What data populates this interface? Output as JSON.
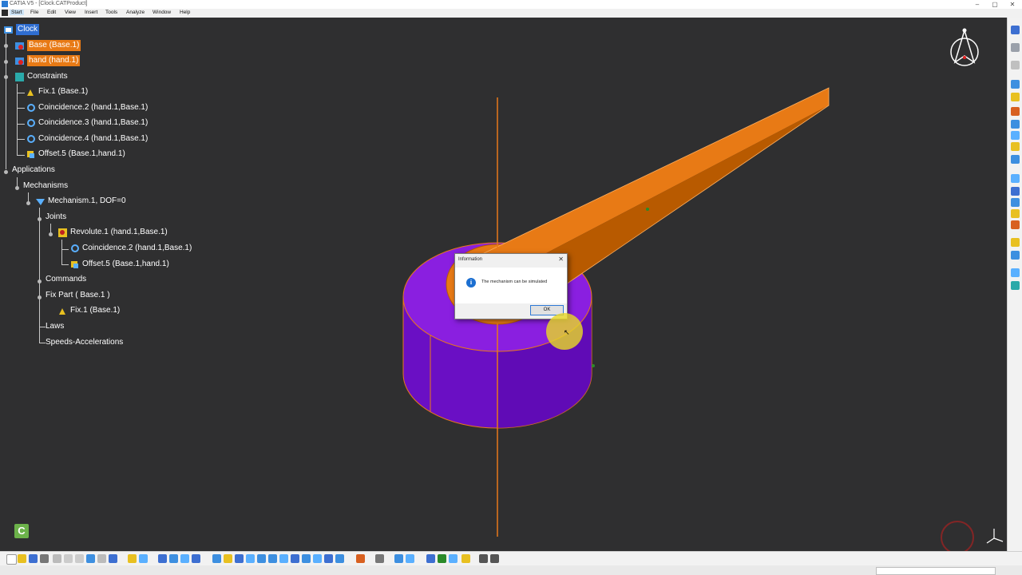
{
  "window": {
    "title": "CATIA V5 - [Clock.CATProduct]",
    "minimize": "–",
    "maximize": "▢",
    "close": "✕"
  },
  "menubar": {
    "items": [
      "Start",
      "File",
      "Edit",
      "View",
      "Insert",
      "Tools",
      "Analyze",
      "Window",
      "Help"
    ]
  },
  "tree": {
    "root": "Clock",
    "base": "Base (Base.1)",
    "hand": "hand (hand.1)",
    "constraints": "Constraints",
    "fix1": "Fix.1 (Base.1)",
    "coincidence2": "Coincidence.2 (hand.1,Base.1)",
    "coincidence3": "Coincidence.3 (hand.1,Base.1)",
    "coincidence4": "Coincidence.4 (hand.1,Base.1)",
    "offset5": "Offset.5 (Base.1,hand.1)",
    "applications": "Applications",
    "mechanisms": "Mechanisms",
    "mechanism1": "Mechanism.1, DOF=0",
    "joints": "Joints",
    "revolute1": "Revolute.1 (hand.1,Base.1)",
    "rev_coincidence2": "Coincidence.2 (hand.1,Base.1)",
    "rev_offset5": "Offset.5 (Base.1,hand.1)",
    "commands": "Commands",
    "fixpart": "Fix Part ( Base.1 )",
    "fixpart_fix1": "Fix.1 (Base.1)",
    "laws": "Laws",
    "speeds": "Speeds-Accelerations"
  },
  "dialog": {
    "title": "Information",
    "close": "✕",
    "message": "The mechanism can be simulated",
    "ok": "OK",
    "info_glyph": "i"
  },
  "colors": {
    "viewport": "#2f2f30",
    "base_top": "#8a1fe0",
    "base_side": "#6a0fc4",
    "hand": "#e87a15",
    "axis": "#e8781a",
    "selection": "#2f6ed1"
  },
  "logo": {
    "glyph": "C"
  }
}
